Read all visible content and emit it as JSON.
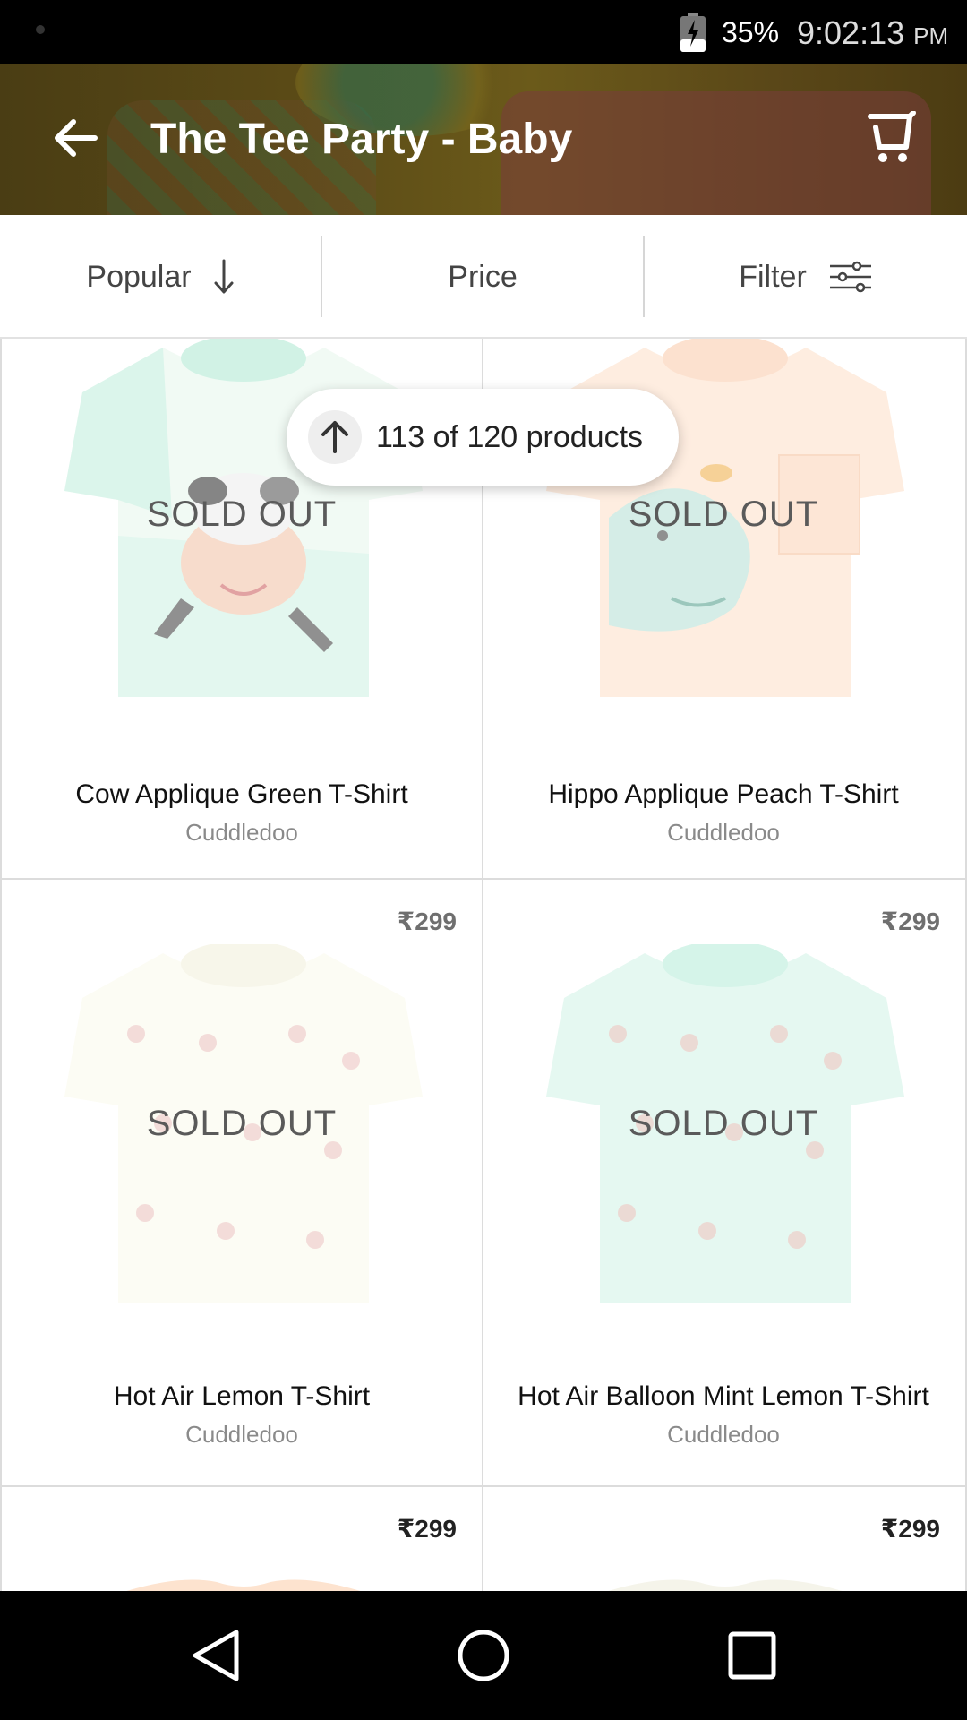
{
  "status_bar": {
    "battery": "35%",
    "time": "9:02:13",
    "ampm": "PM"
  },
  "app_bar": {
    "title": "The Tee Party - Baby"
  },
  "sort_bar": {
    "popular_label": "Popular",
    "price_label": "Price",
    "filter_label": "Filter"
  },
  "count_pill": {
    "text": "113 of 120 products"
  },
  "products": [
    {
      "name": "Cow Applique Green T-Shirt",
      "brand": "Cuddledoo",
      "status": "SOLD OUT",
      "price": ""
    },
    {
      "name": "Hippo Applique Peach T-Shirt",
      "brand": "Cuddledoo",
      "status": "SOLD OUT",
      "price": ""
    },
    {
      "name": "Hot Air Lemon T-Shirt",
      "brand": "Cuddledoo",
      "status": "SOLD OUT",
      "price": "₹299"
    },
    {
      "name": "Hot Air Balloon Mint Lemon T-Shirt",
      "brand": "Cuddledoo",
      "status": "SOLD OUT",
      "price": "₹299"
    },
    {
      "name": "",
      "brand": "",
      "status": "",
      "price": "₹299"
    },
    {
      "name": "",
      "brand": "",
      "status": "",
      "price": "₹299"
    }
  ],
  "icons": {
    "back": "arrow-left-icon",
    "cart": "cart-icon",
    "sort_direction": "arrow-down-icon",
    "filter": "sliders-icon",
    "scroll_top": "arrow-up-icon"
  },
  "colors": {
    "status_bar": "#000000",
    "app_bar_text": "#ffffff",
    "soldout_text": "#5a5a5a",
    "brand_text": "#8a8a8a"
  }
}
